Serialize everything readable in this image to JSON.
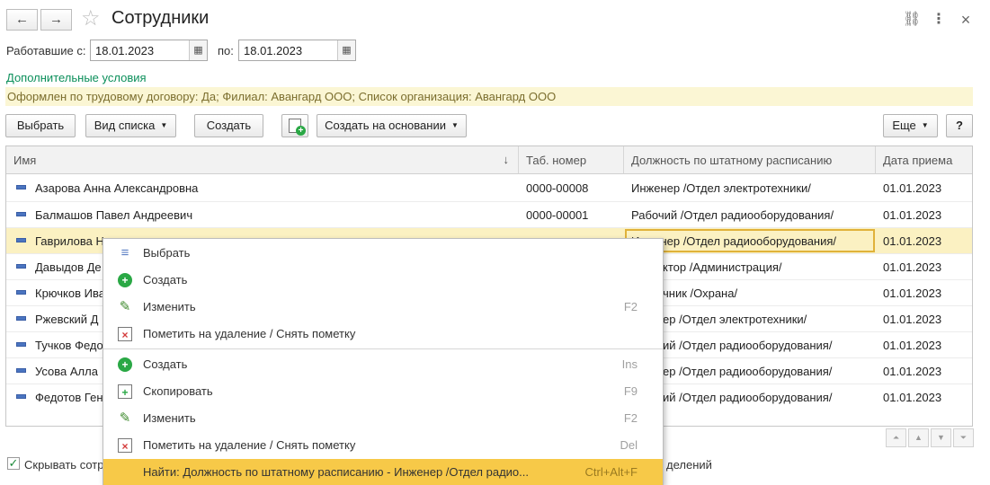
{
  "header": {
    "title": "Сотрудники",
    "back_icon": "←",
    "forward_icon": "→",
    "star_icon": "☆",
    "link_icon": "⛓",
    "more_icon": "⋮",
    "close_icon": "×"
  },
  "period": {
    "from_label": "Работавшие с:",
    "from_value": "18.01.2023",
    "to_label": "по:",
    "to_value": "18.01.2023",
    "calendar_icon": "▦"
  },
  "extra_conditions_link": "Дополнительные условия",
  "filter_text": "Оформлен по трудовому договору: Да; Филиал: Авангард ООО; Список организация: Авангард ООО",
  "toolbar": {
    "select_label": "Выбрать",
    "list_view_label": "Вид списка",
    "create_label": "Создать",
    "create_copy_icon": "+",
    "create_based_label": "Создать на основании",
    "more_label": "Еще",
    "help_label": "?",
    "caret": "▼"
  },
  "table": {
    "columns": [
      "Имя",
      "Таб. номер",
      "Должность по штатному расписанию",
      "Дата приема"
    ],
    "sort_icon": "↓",
    "rows": [
      {
        "name": "Азарова Анна Александровна",
        "tab": "0000-00008",
        "position": "Инженер /Отдел электротехники/",
        "date": "01.01.2023"
      },
      {
        "name": "Балмашов Павел Андреевич",
        "tab": "0000-00001",
        "position": "Рабочий /Отдел радиооборудования/",
        "date": "01.01.2023"
      },
      {
        "name": "Гаврилова Н",
        "tab": "",
        "position": "Инженер /Отдел радиооборудования/",
        "date": "01.01.2023"
      },
      {
        "name": "Давыдов Де",
        "tab": "",
        "position": "ктор /Администрация/",
        "date": "01.01.2023"
      },
      {
        "name": "Крючков Ива",
        "tab": "",
        "position": "чник /Охрана/",
        "date": "01.01.2023"
      },
      {
        "name": "Ржевский Д",
        "tab": "",
        "position": "ер /Отдел электротехники/",
        "date": "01.01.2023"
      },
      {
        "name": "Тучков Федо",
        "tab": "",
        "position": "ий /Отдел радиооборудования/",
        "date": "01.01.2023"
      },
      {
        "name": "Усова Алла",
        "tab": "",
        "position": "ер /Отдел радиооборудования/",
        "date": "01.01.2023"
      },
      {
        "name": "Федотов Ген",
        "tab": "",
        "position": "ий /Отдел радиооборудования/",
        "date": "01.01.2023"
      }
    ]
  },
  "context_menu": {
    "items": [
      {
        "label": "Выбрать",
        "shortcut": "",
        "icon": "select-icon",
        "glyph": "≡"
      },
      {
        "label": "Создать",
        "shortcut": "",
        "icon": "add-icon",
        "glyph": "+"
      },
      {
        "label": "Изменить",
        "shortcut": "F2",
        "icon": "pencil-icon",
        "glyph": "✎"
      },
      {
        "label": "Пометить на удаление / Снять пометку",
        "shortcut": "",
        "icon": "delete-mark-icon",
        "glyph": "×"
      },
      {
        "label": "Создать",
        "shortcut": "Ins",
        "icon": "add-icon",
        "glyph": "+"
      },
      {
        "label": "Скопировать",
        "shortcut": "F9",
        "icon": "copy-icon",
        "glyph": "+"
      },
      {
        "label": "Изменить",
        "shortcut": "F2",
        "icon": "pencil-icon",
        "glyph": "✎"
      },
      {
        "label": "Пометить на удаление / Снять пометку",
        "shortcut": "Del",
        "icon": "delete-mark-icon",
        "glyph": "×"
      },
      {
        "label": "Найти: Должность по штатному расписанию - Инженер /Отдел радио...",
        "shortcut": "Ctrl+Alt+F",
        "icon": "find-icon",
        "glyph": ""
      }
    ]
  },
  "scroll_glyphs": {
    "first": "⏶",
    "up": "▲",
    "down": "▼",
    "last": "⏷"
  },
  "footer": {
    "hide_label": "Скрывать сотр",
    "checkmark": "✓",
    "right_fragment": "делений"
  },
  "colors": {
    "accent_green": "#0b8f5a",
    "selection": "#fbf1c2",
    "menu_highlight": "#f7c948",
    "filter_bg": "#fbf6d4"
  }
}
